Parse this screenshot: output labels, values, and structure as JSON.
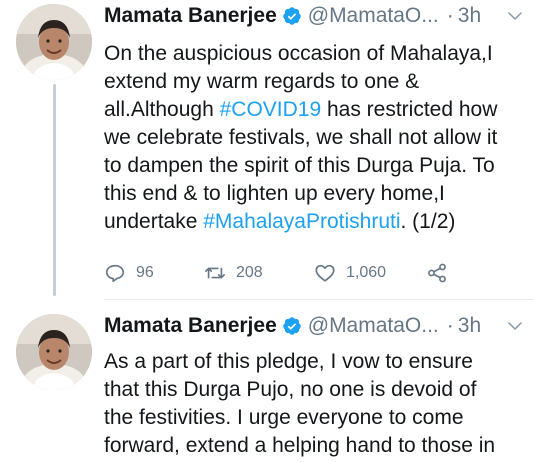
{
  "colors": {
    "link": "#1da1f2",
    "secondary": "#657786",
    "text": "#14171a",
    "thread_line": "#c4cfd6"
  },
  "tweets": [
    {
      "author": "Mamata Banerjee",
      "handle": "@MamataO...",
      "separator": "·",
      "time": "3h",
      "avatar_icon": "profile-photo",
      "verified_icon": "verified-badge-icon",
      "text": {
        "l1": "On the auspicious occasion of Mahalaya,I",
        "l2": "extend my warm regards to one &",
        "l3a": "all.Although ",
        "l3h": "#COVID19",
        "l3b": " has restricted how",
        "l4": "we celebrate festivals, we shall not allow it",
        "l5": "to dampen the spirit of this Durga Puja. To",
        "l6": "this end & to lighten up every home,I",
        "l7a": "undertake ",
        "l7h": "#MahalayaProtishruti",
        "l7b": ". (1/2)"
      },
      "stats": {
        "replies": "96",
        "retweets": "208",
        "likes": "1,060"
      }
    },
    {
      "author": "Mamata Banerjee",
      "handle": "@MamataO...",
      "separator": "·",
      "time": "3h",
      "avatar_icon": "profile-photo",
      "verified_icon": "verified-badge-icon",
      "text": {
        "l1": "As a part of this pledge, I vow to ensure",
        "l2": "that this Durga Pujo, no one is devoid of",
        "l3": "the festivities. I urge everyone to come",
        "l4": "forward, extend a helping hand to those in"
      }
    }
  ]
}
